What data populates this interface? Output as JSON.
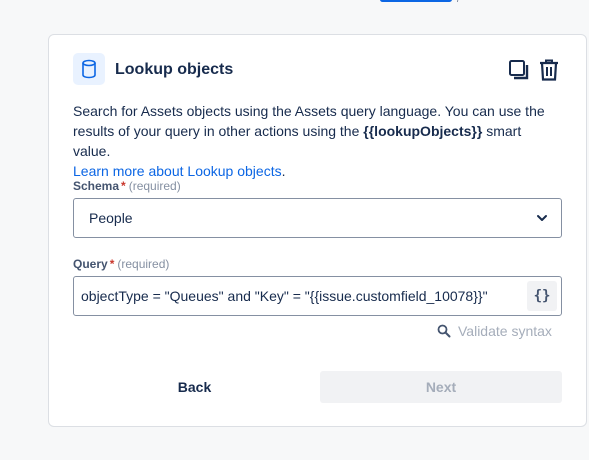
{
  "card": {
    "title": "Lookup objects",
    "header_icon": "database-icon",
    "actions": {
      "duplicate_icon": "duplicate-icon",
      "delete_icon": "trash-icon"
    },
    "description": {
      "text_part1": "Search for Assets objects using the Assets query language. You can use the results of your query in other actions using the ",
      "smart_value": "{{lookupObjects}}",
      "text_part2": " smart value.",
      "link_text": "Learn more about Lookup objects",
      "text_part3": "."
    }
  },
  "schema": {
    "label": "Schema",
    "required_star": "*",
    "required_text": "(required)",
    "value": "People",
    "chevron_icon": "chevron-down-icon"
  },
  "query": {
    "label": "Query",
    "required_star": "*",
    "required_text": "(required)",
    "value": "objectType = \"Queues\" and \"Key\" = \"{{issue.customfield_10078}}\"",
    "braces_label": "{}"
  },
  "validate": {
    "icon": "search-icon",
    "label": "Validate syntax"
  },
  "footer": {
    "back_label": "Back",
    "next_label": "Next"
  },
  "colors": {
    "accent": "#0c66e4",
    "required": "#c9372c",
    "disabled_text": "#a5adba",
    "icon_background": "#e9f2ff"
  }
}
